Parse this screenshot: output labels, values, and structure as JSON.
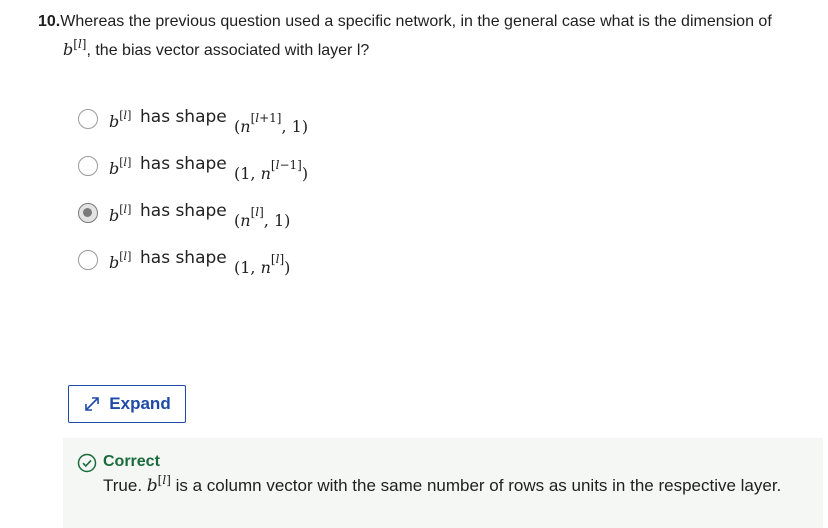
{
  "question": {
    "number": "10.",
    "text_line1": "Whereas the previous question used a specific network, in the general case what is the dimension of",
    "text_line2_suffix": ", the bias vector associated with layer l?"
  },
  "options": [
    {
      "label": "has shape",
      "shape": "(n^[l+1], 1)",
      "selected": false
    },
    {
      "label": "has shape",
      "shape": "(1, n^[l−1])",
      "selected": false
    },
    {
      "label": "has shape",
      "shape": "(n^[l], 1)",
      "selected": true
    },
    {
      "label": "has shape",
      "shape": "(1, n^[l])",
      "selected": false
    }
  ],
  "expand": {
    "label": "Expand"
  },
  "feedback": {
    "status": "Correct",
    "text_prefix": "True.",
    "text_suffix": "is a column vector with the same number of rows as units in the respective layer."
  },
  "colors": {
    "accent": "#1f4aa8",
    "correct": "#1a6b3c",
    "feedback_bg": "#f5f7f5"
  }
}
